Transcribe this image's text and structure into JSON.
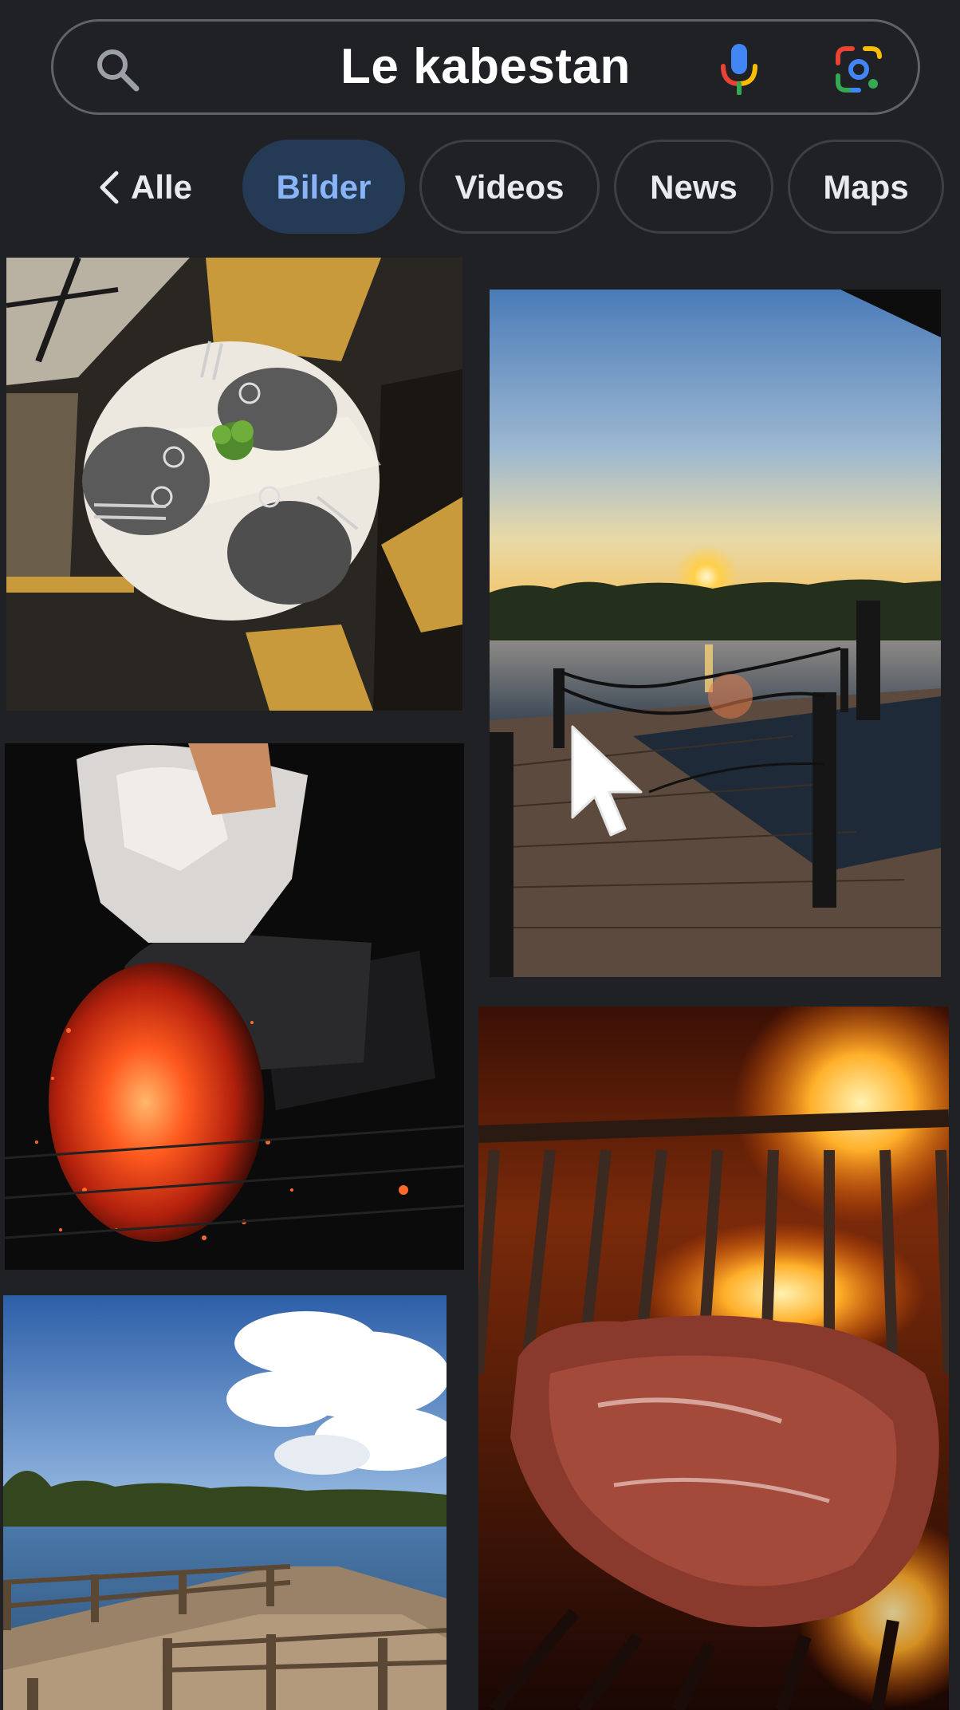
{
  "search": {
    "query": "Le kabestan"
  },
  "tabs": {
    "back_label": "Alle",
    "items": [
      {
        "label": "Bilder",
        "active": true
      },
      {
        "label": "Videos",
        "active": false
      },
      {
        "label": "News",
        "active": false
      },
      {
        "label": "Maps",
        "active": false
      }
    ]
  },
  "results": [
    {
      "subject": "Restaurant table from above"
    },
    {
      "subject": "Sunset over lake with wooden deck"
    },
    {
      "subject": "Charcoal chimney with glowing embers"
    },
    {
      "subject": "Steak on flaming grill"
    },
    {
      "subject": "Lake with wooden pier"
    }
  ],
  "colors": {
    "background": "#1f2125",
    "active_tab_bg": "#253a55",
    "active_tab_text": "#8ab4f8",
    "google_blue": "#4285f4",
    "google_red": "#ea4335",
    "google_yellow": "#fbbc04",
    "google_green": "#34a853"
  }
}
